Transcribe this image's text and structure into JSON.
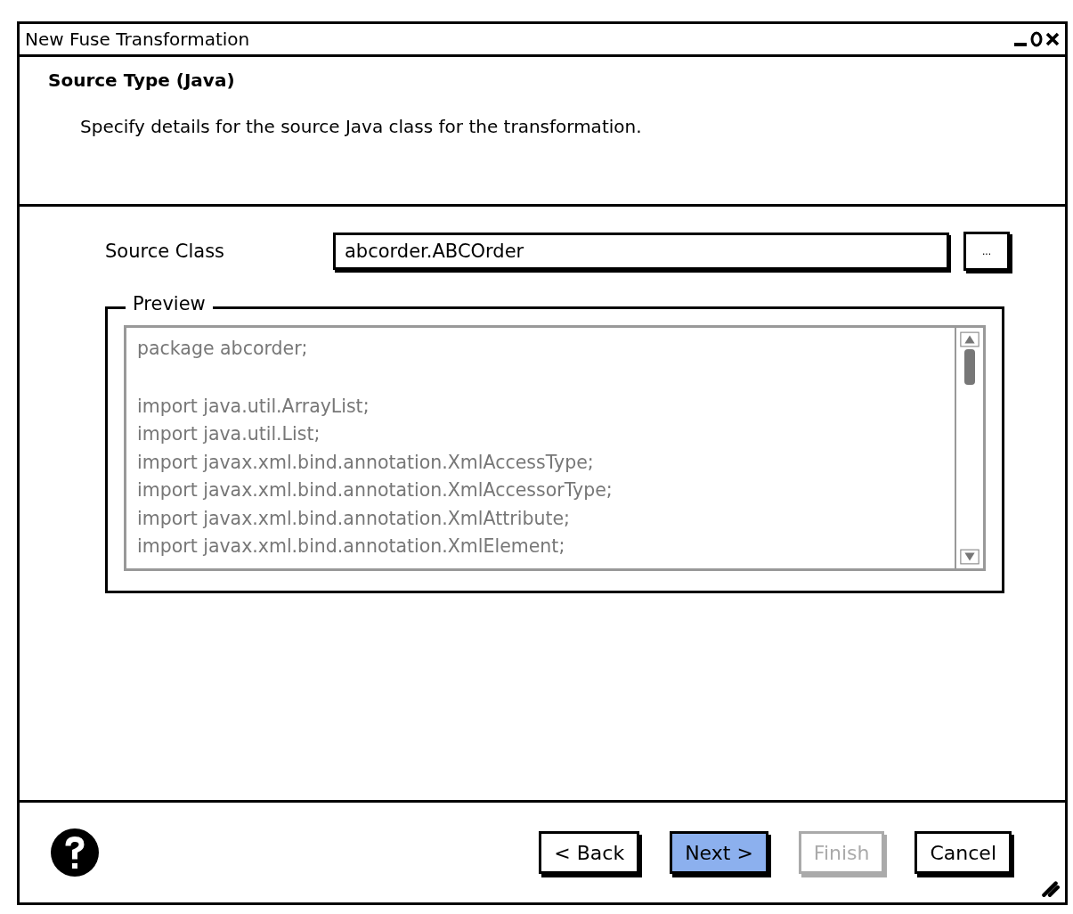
{
  "window": {
    "title": "New Fuse Transformation",
    "controls": [
      {
        "kind": "minimize"
      },
      {
        "kind": "maximize"
      },
      {
        "kind": "close"
      }
    ]
  },
  "header": {
    "title": "Source Type (Java)",
    "description": "Specify details for the source Java class for the transformation."
  },
  "source_class": {
    "label": "Source Class",
    "value": "abcorder.ABCOrder",
    "browse_label": "..."
  },
  "preview": {
    "legend": "Preview",
    "blocks": [
      [
        "package abcorder;"
      ],
      [
        "import java.util.ArrayList;",
        "import java.util.List;",
        "import javax.xml.bind.annotation.XmlAccessType;",
        "import javax.xml.bind.annotation.XmlAccessorType;",
        "import javax.xml.bind.annotation.XmlAttribute;",
        "import javax.xml.bind.annotation.XmlElement;"
      ]
    ]
  },
  "buttons": [
    {
      "label": "< Back",
      "selected": false,
      "disabled": false
    },
    {
      "label": "Next >",
      "selected": true,
      "disabled": false
    },
    {
      "label": "Finish",
      "selected": false,
      "disabled": true
    },
    {
      "label": "Cancel",
      "selected": false,
      "disabled": false
    }
  ]
}
